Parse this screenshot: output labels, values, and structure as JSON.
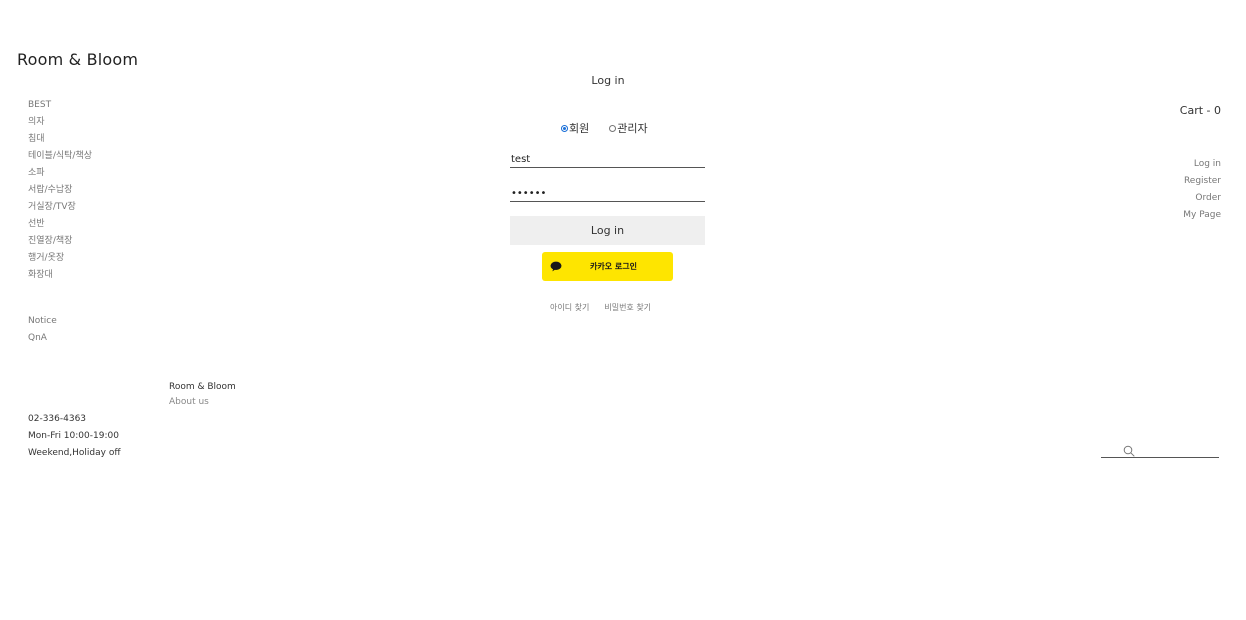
{
  "site": {
    "logo": "Room & Bloom"
  },
  "categories": [
    "BEST",
    "의자",
    "침대",
    "테이블/식탁/책상",
    "소파",
    "서랍/수납장",
    "거실장/TV장",
    "선반",
    "진열장/책장",
    "행거/옷장",
    "화장대"
  ],
  "boards": [
    "Notice",
    "QnA"
  ],
  "footer": {
    "brand": "Room & Bloom",
    "about": "About us",
    "phone": "02-336-4363",
    "hours": "Mon-Fri 10:00-19:00",
    "closed": "Weekend,Holiday off"
  },
  "cart": {
    "label": "Cart - 0"
  },
  "user_menu": [
    "Log in",
    "Register",
    "Order",
    "My Page"
  ],
  "search": {
    "value": "",
    "placeholder": ""
  },
  "login": {
    "title": "Log in",
    "roles": [
      {
        "label": "회원",
        "checked": true
      },
      {
        "label": "관리자",
        "checked": false
      }
    ],
    "id_value": "test",
    "password_value": "••••••",
    "submit_label": "Log in",
    "kakao_label": "카카오 로그인",
    "find_id": "아이디 찾기",
    "find_password": "비밀번호 찾기"
  },
  "colors": {
    "kakao": "#fee500",
    "button_bg": "#efefef",
    "radio_checked": "#1a6fd8"
  }
}
